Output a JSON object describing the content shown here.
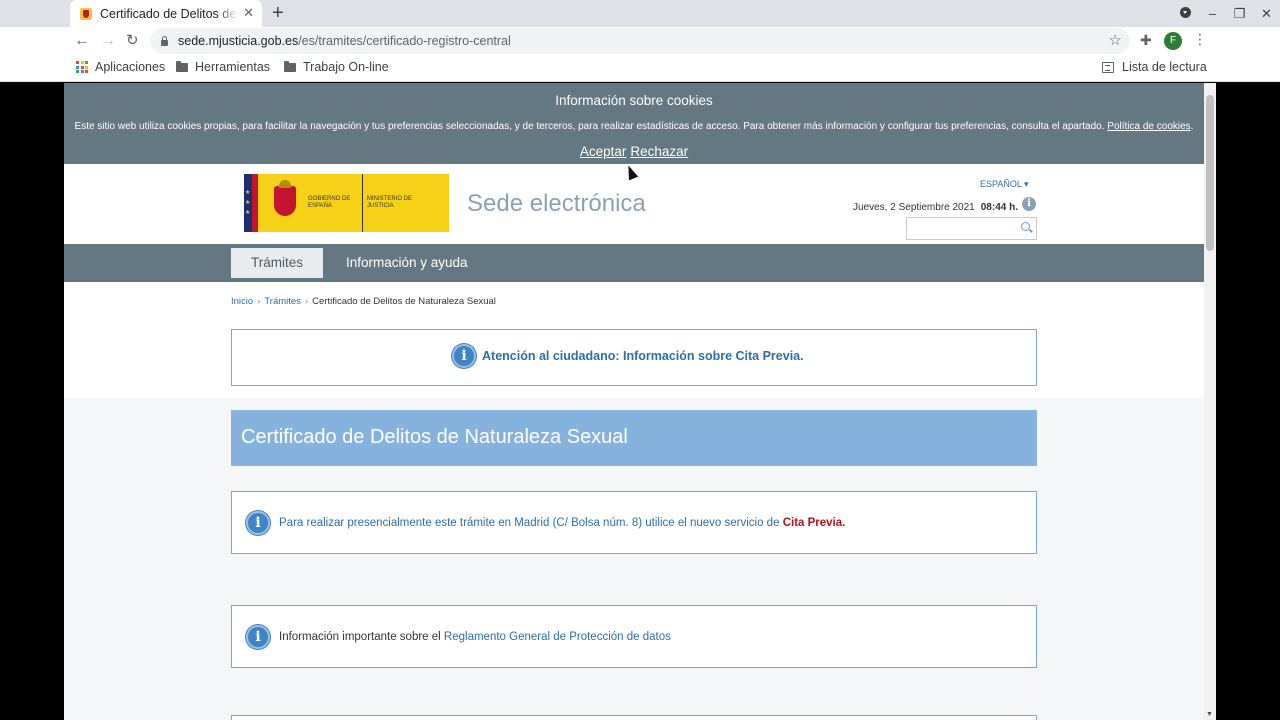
{
  "browser": {
    "tab_title": "Certificado de Delitos de Naturaleza Sexual",
    "url_host": "sede.mjusticia.gob.es",
    "url_path": "/es/tramites/certificado-registro-central",
    "profile_initial": "F",
    "bookmarks": {
      "apps": "Aplicaciones",
      "tools": "Herramientas",
      "online": "Trabajo On-line",
      "reading_list": "Lista de lectura"
    }
  },
  "cookie_banner": {
    "title": "Información sobre cookies",
    "text": "Este sitio web utiliza cookies propias, para facilitar la navegación y tus preferencias seleccionadas, y de terceros, para realizar estadísticas de acceso. Para obtener más información y configurar tus preferencias, consulta el apartado.",
    "policy_link": "Política de cookies",
    "accept": "Aceptar",
    "reject": "Rechazar"
  },
  "header": {
    "logo_gobierno": "Gobierno de España",
    "logo_ministerio": "Ministerio de Justicia",
    "site_title": "Sede electrónica",
    "language": "ESPAÑOL ▾",
    "date": "Jueves, 2 Septiembre 2021",
    "time": "08:44 h.",
    "search_value": ""
  },
  "menu": {
    "tramites": "Trámites",
    "info": "Información y ayuda"
  },
  "breadcrumb": {
    "home": "Inicio",
    "section": "Trámites",
    "current": "Certificado de Delitos de Naturaleza Sexual"
  },
  "notices": {
    "attention": "Atención al ciudadano: Información sobre Cita Previa.",
    "page_title": "Certificado de Delitos de Naturaleza Sexual",
    "presencial_text": "Para realizar presencialmente este trámite en Madrid (C/ Bolsa núm. 8) utilice el nuevo servicio de",
    "cita_previa": "Cita Previa.",
    "rgpd_text": "Información importante sobre el",
    "rgpd_link": "Reglamento General de Protección de datos"
  },
  "colors": {
    "bar": "#647884",
    "banner": "#86b3de",
    "link": "#2e6ea6",
    "cita_previa": "#b4121a"
  }
}
